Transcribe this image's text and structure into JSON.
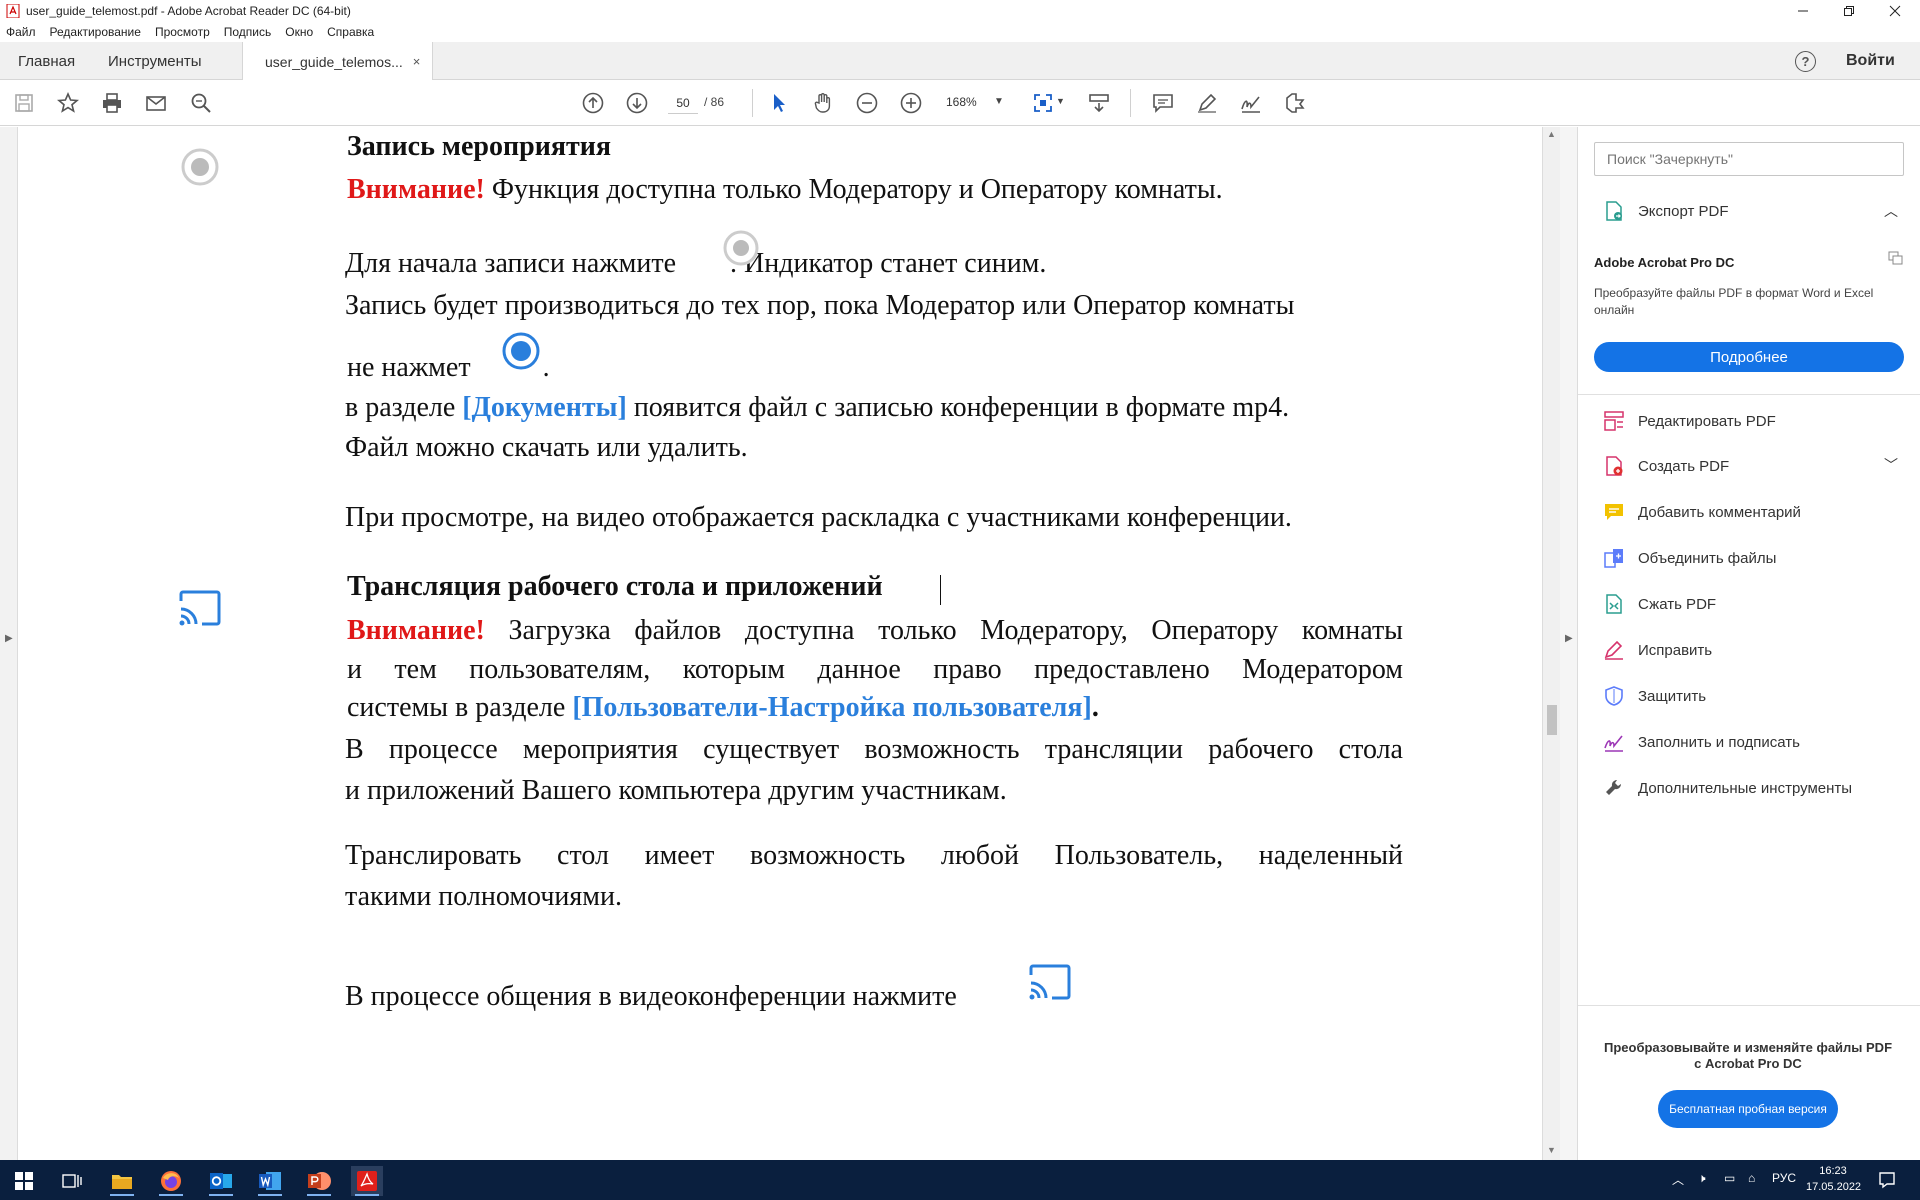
{
  "window": {
    "title": "user_guide_telemost.pdf - Adobe Acrobat Reader DC (64-bit)"
  },
  "menu": [
    "Файл",
    "Редактирование",
    "Просмотр",
    "Подпись",
    "Окно",
    "Справка"
  ],
  "tabs": {
    "home": "Главная",
    "tools": "Инструменты",
    "doc": "user_guide_telemos...",
    "close": "×",
    "help": "?",
    "signin": "Войти"
  },
  "toolbar": {
    "page_current": "50",
    "page_total": "/ 86",
    "zoom": "168%"
  },
  "document": {
    "h1": "Запись мероприятия",
    "warn1": "Внимание!",
    "warn1_text": " Функция доступна только Модератору и Оператору комнаты.",
    "p1a": "Для начала записи нажмите",
    "p1b": ". Индикатор станет синим.",
    "p2": "Запись будет производиться до тех пор, пока Модератор или Оператор комнаты",
    "p2b": "не нажмет",
    "p2c": ".",
    "p3a": "в разделе ",
    "p3link": "[Документы]",
    "p3b": " появится файл с записью конференции в формате mp4.",
    "p4": "Файл можно скачать или удалить.",
    "p5": "При просмотре, на видео отображается раскладка с участниками конференции.",
    "h2": "Трансляция рабочего стола и приложений",
    "warn2": "Внимание!",
    "warn2_l1": " Загрузка файлов доступна только Модератору, Оператору комнаты",
    "warn2_l2": "и тем пользователям, которым данное право предоставлено Модератором",
    "warn2_l3": "системы в разделе ",
    "warn2_link": "[Пользователи-Настройка пользователя]",
    "warn2_end": ".",
    "p6_l1": "В процессе мероприятия существует возможность трансляции рабочего стола",
    "p6_l2": "и приложений Вашего компьютера другим участникам.",
    "p7_l1": "Транслировать стол имеет возможность любой Пользователь, наделенный",
    "p7_l2": "такими полномочиями.",
    "p8": "В процессе общения в видеоконференции нажмите"
  },
  "panel": {
    "search_placeholder": "Поиск \"Зачеркнуть\"",
    "export": "Экспорт PDF",
    "promo_title": "Adobe Acrobat Pro DC",
    "promo_text": "Преобразуйте файлы PDF в формат Word и Excel онлайн",
    "promo_btn": "Подробнее",
    "items": [
      "Редактировать PDF",
      "Создать PDF",
      "Добавить комментарий",
      "Объединить файлы",
      "Сжать PDF",
      "Исправить",
      "Защитить",
      "Заполнить и подписать",
      "Дополнительные инструменты"
    ],
    "bottom_l1": "Преобразовывайте и изменяйте файлы PDF",
    "bottom_l2": "с Acrobat Pro DC",
    "trial_btn": "Бесплатная пробная версия"
  },
  "taskbar": {
    "lang": "РУС",
    "time": "16:23",
    "date": "17.05.2022"
  },
  "colors": {
    "accent": "#1473e6",
    "warning_red": "#e01818",
    "link_blue": "#2a7fdc",
    "taskbar": "#0a1f3e"
  }
}
